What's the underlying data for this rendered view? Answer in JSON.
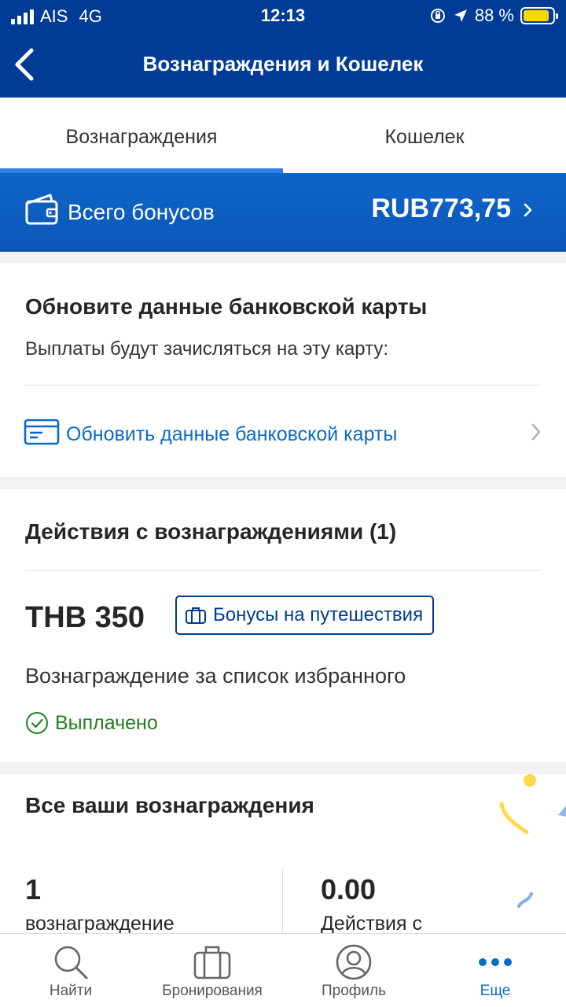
{
  "status_bar": {
    "carrier": "AIS",
    "network": "4G",
    "time": "12:13",
    "battery_text": "88 %",
    "battery_level": 0.88
  },
  "nav": {
    "title": "Вознаграждения и Кошелек",
    "back_icon": "chevron-left-icon"
  },
  "tabs": [
    {
      "label": "Вознаграждения",
      "active": true
    },
    {
      "label": "Кошелек",
      "active": false
    }
  ],
  "bonus_banner": {
    "label": "Всего бонусов",
    "value": "RUB773,75",
    "icon": "wallet-icon"
  },
  "bank_card": {
    "title": "Обновите данные банковской карты",
    "subtitle": "Выплаты будут зачисляться на эту карту:",
    "link": "Обновить данные банковской карты",
    "icon": "credit-card-icon"
  },
  "reward_actions": {
    "title": "Действия с вознаграждениями (1)",
    "amount": "THB 350",
    "tag": "Бонусы на путешествия",
    "description": "Вознаграждение за список избранного",
    "status": "Выплачено",
    "status_color": "#208020"
  },
  "all_rewards": {
    "title": "Все ваши вознаграждения",
    "stats": [
      {
        "value": "1",
        "label": "вознаграждение"
      },
      {
        "value": "0.00",
        "label": "Действия с"
      }
    ]
  },
  "bottom_tabs": [
    {
      "label": "Найти",
      "icon": "search-icon",
      "active": false
    },
    {
      "label": "Бронирования",
      "icon": "suitcase-icon",
      "active": false
    },
    {
      "label": "Профиль",
      "icon": "profile-icon",
      "active": false
    },
    {
      "label": "Еще",
      "icon": "more-icon",
      "active": true
    }
  ],
  "colors": {
    "brand_blue": "#003c96",
    "link_blue": "#0a6bc9",
    "active_tab_underline": "#2d7de2",
    "success_green": "#208020"
  }
}
